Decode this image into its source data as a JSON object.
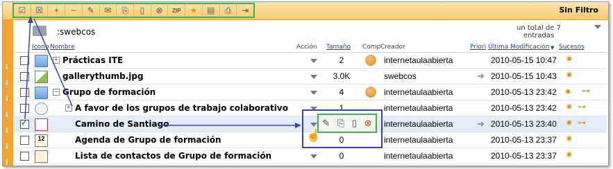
{
  "toolbar": {
    "buttons": [
      {
        "name": "select-all",
        "glyph": "☑"
      },
      {
        "name": "deselect",
        "glyph": "☒"
      },
      {
        "name": "expand",
        "glyph": "+"
      },
      {
        "name": "collapse",
        "glyph": "−"
      },
      {
        "name": "edit",
        "glyph": "✎"
      },
      {
        "name": "mail",
        "glyph": "✉"
      },
      {
        "name": "copy",
        "glyph": "⎘"
      },
      {
        "name": "doc",
        "glyph": "▯"
      },
      {
        "name": "delete",
        "glyph": "⊗"
      },
      {
        "name": "zip",
        "glyph": "ZIP"
      },
      {
        "name": "star",
        "glyph": "★"
      },
      {
        "name": "card",
        "glyph": "▤"
      },
      {
        "name": "print",
        "glyph": "⎙"
      },
      {
        "name": "export",
        "glyph": "⇥"
      }
    ],
    "filter_label": "Sin Filtro"
  },
  "location": {
    "path": ":swebcos",
    "total_text_1": "un total de 7",
    "total_text_2": "entradas"
  },
  "columns": {
    "icono": "Icono",
    "nombre": "Nombre",
    "accion": "Acción",
    "tamano": "Tamaño",
    "comp": "Comp",
    "creador": "Creador",
    "prior": "Priori",
    "modificacion": "Última Modificación",
    "sucesos": "Sucesos"
  },
  "rows": [
    {
      "name": "Prácticas ITE",
      "size": "2",
      "creator": "internetaulaabierta",
      "date": "2010-05-15 10:47"
    },
    {
      "name": "gallerythumb.jpg",
      "size": "3.0K",
      "creator": "swebcos",
      "date": "2010-05-15 10:43"
    },
    {
      "name": "Grupo de formación",
      "size": "4",
      "creator": "internetaulaabierta",
      "date": "2010-05-13 23:42"
    },
    {
      "name": "A favor de los grupos de trabajo colaborativo",
      "size": "1",
      "creator": "internetaulaabierta",
      "date": "2010-05-13 23:42"
    },
    {
      "name": "Camino de Santiago",
      "size": "",
      "creator": "internetaulaabierta",
      "date": "2010-05-13 23:40"
    },
    {
      "name": "Agenda de Grupo de formación",
      "size": "0",
      "creator": "internetaulaabierta",
      "date": "2010-05-13 23:37"
    },
    {
      "name": "Lista de contactos de Grupo de formación",
      "size": "0",
      "creator": "internetaulaabierta",
      "date": "2010-05-13 23:37"
    }
  ],
  "colors": {
    "toolbar_bg": "#f6c770",
    "info_bar": "#f4a335",
    "highlight_green": "#3bb24a",
    "highlight_blue": "#3a3fbf",
    "link": "#1a3fb0"
  }
}
